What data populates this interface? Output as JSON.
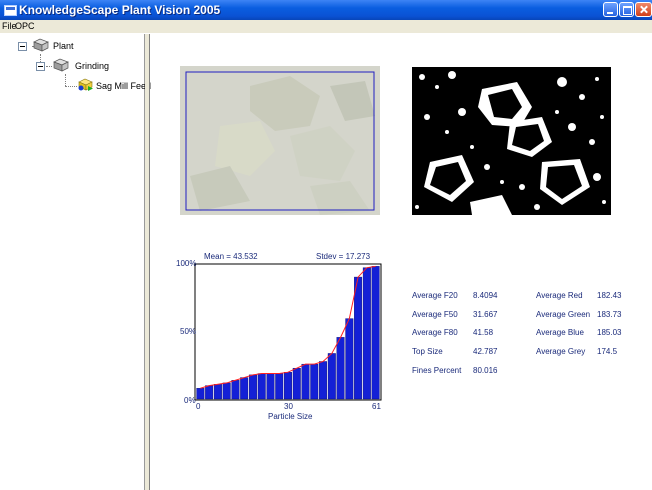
{
  "window": {
    "title": "KnowledgeScape Plant Vision 2005"
  },
  "menu": {
    "items": [
      "File",
      "OPC"
    ]
  },
  "tree": {
    "root": {
      "label": "Plant"
    },
    "child": {
      "label": "Grinding"
    },
    "leaf": {
      "label": "Sag Mill Feed"
    }
  },
  "histogram": {
    "mean_label": "Mean = 43.532",
    "stdev_label": "Stdev = 17.273",
    "xlabel": "Particle Size",
    "y_ticks": [
      "100%",
      "50%",
      "0%"
    ],
    "x_ticks": [
      "0",
      "30",
      "61"
    ]
  },
  "chart_data": {
    "type": "bar",
    "title": "",
    "xlabel": "Particle Size",
    "ylabel": "",
    "x": [
      0,
      3,
      6,
      9,
      12,
      15,
      18,
      21,
      24,
      27,
      30,
      33,
      36,
      39,
      42,
      45,
      48,
      51,
      54,
      57,
      60
    ],
    "values": [
      8,
      10,
      11,
      12,
      14,
      16,
      18,
      19,
      19,
      19,
      20,
      23,
      26,
      26,
      28,
      34,
      46,
      60,
      91,
      98,
      99
    ],
    "xlim": [
      0,
      61
    ],
    "ylim": [
      0,
      100
    ],
    "y_unit": "%",
    "annotations": [
      "Mean = 43.532",
      "Stdev = 17.273"
    ],
    "colors": {
      "bar": "#1420d6",
      "line": "#ff2020"
    }
  },
  "stats": {
    "left": [
      {
        "label": "Average F20",
        "value": "8.4094"
      },
      {
        "label": "Average F50",
        "value": "31.667"
      },
      {
        "label": "Average F80",
        "value": "41.58"
      },
      {
        "label": "Top Size",
        "value": "42.787"
      },
      {
        "label": "Fines Percent",
        "value": "80.016"
      }
    ],
    "right": [
      {
        "label": "Average Red",
        "value": "182.43"
      },
      {
        "label": "Average Green",
        "value": "183.73"
      },
      {
        "label": "Average Blue",
        "value": "185.03"
      },
      {
        "label": "Average Grey",
        "value": "174.5"
      }
    ]
  }
}
